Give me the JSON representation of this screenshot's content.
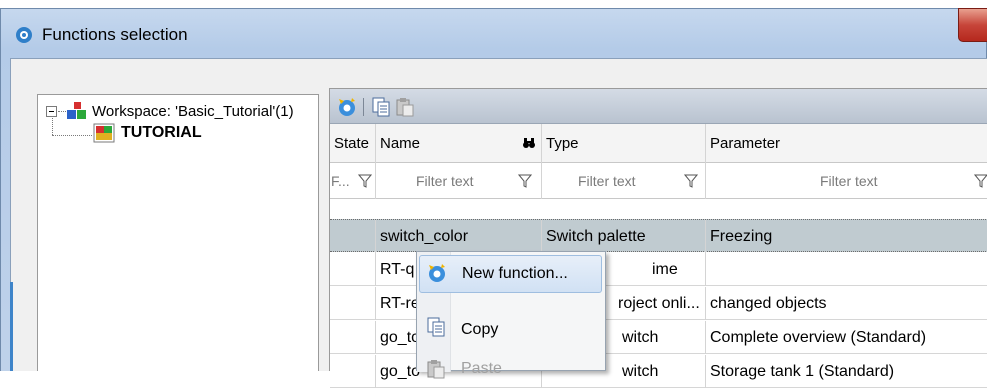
{
  "window": {
    "title": "Functions selection",
    "icon": "app-gear-icon",
    "close_icon": "close-icon"
  },
  "tree": {
    "root_label": "Workspace: 'Basic_Tutorial'(1)",
    "child_label": "TUTORIAL"
  },
  "toolbar": {
    "buttons": [
      "new-function-icon",
      "copy-icon",
      "paste-icon"
    ]
  },
  "grid": {
    "columns": [
      "State",
      "Name",
      "Type",
      "Parameter"
    ],
    "filter_state": "F...",
    "filter_placeholder": "Filter text",
    "rows": [
      {
        "state": "",
        "name": "switch_color",
        "type": "Switch palette",
        "parameter": "Freezing",
        "selected": true
      },
      {
        "state": "",
        "name": "RT-q",
        "type": "ime",
        "parameter": ""
      },
      {
        "state": "",
        "name": "RT-re",
        "type": "roject onli...",
        "parameter": "changed objects"
      },
      {
        "state": "",
        "name": "go_to",
        "type": "witch",
        "parameter": "Complete overview (Standard)"
      },
      {
        "state": "",
        "name": "go_to",
        "type": "witch",
        "parameter": "Storage tank 1 (Standard)"
      }
    ]
  },
  "context_menu": {
    "items": [
      {
        "label": "New function...",
        "icon": "new-function-icon",
        "highlighted": true
      },
      {
        "label": "Copy",
        "icon": "copy-icon"
      },
      {
        "label": "Paste",
        "icon": "paste-icon",
        "disabled": true
      }
    ]
  },
  "colors": {
    "selection": "#c0cbd0",
    "titlebar": "#b4cbe8",
    "close_button": "#c7453a"
  }
}
